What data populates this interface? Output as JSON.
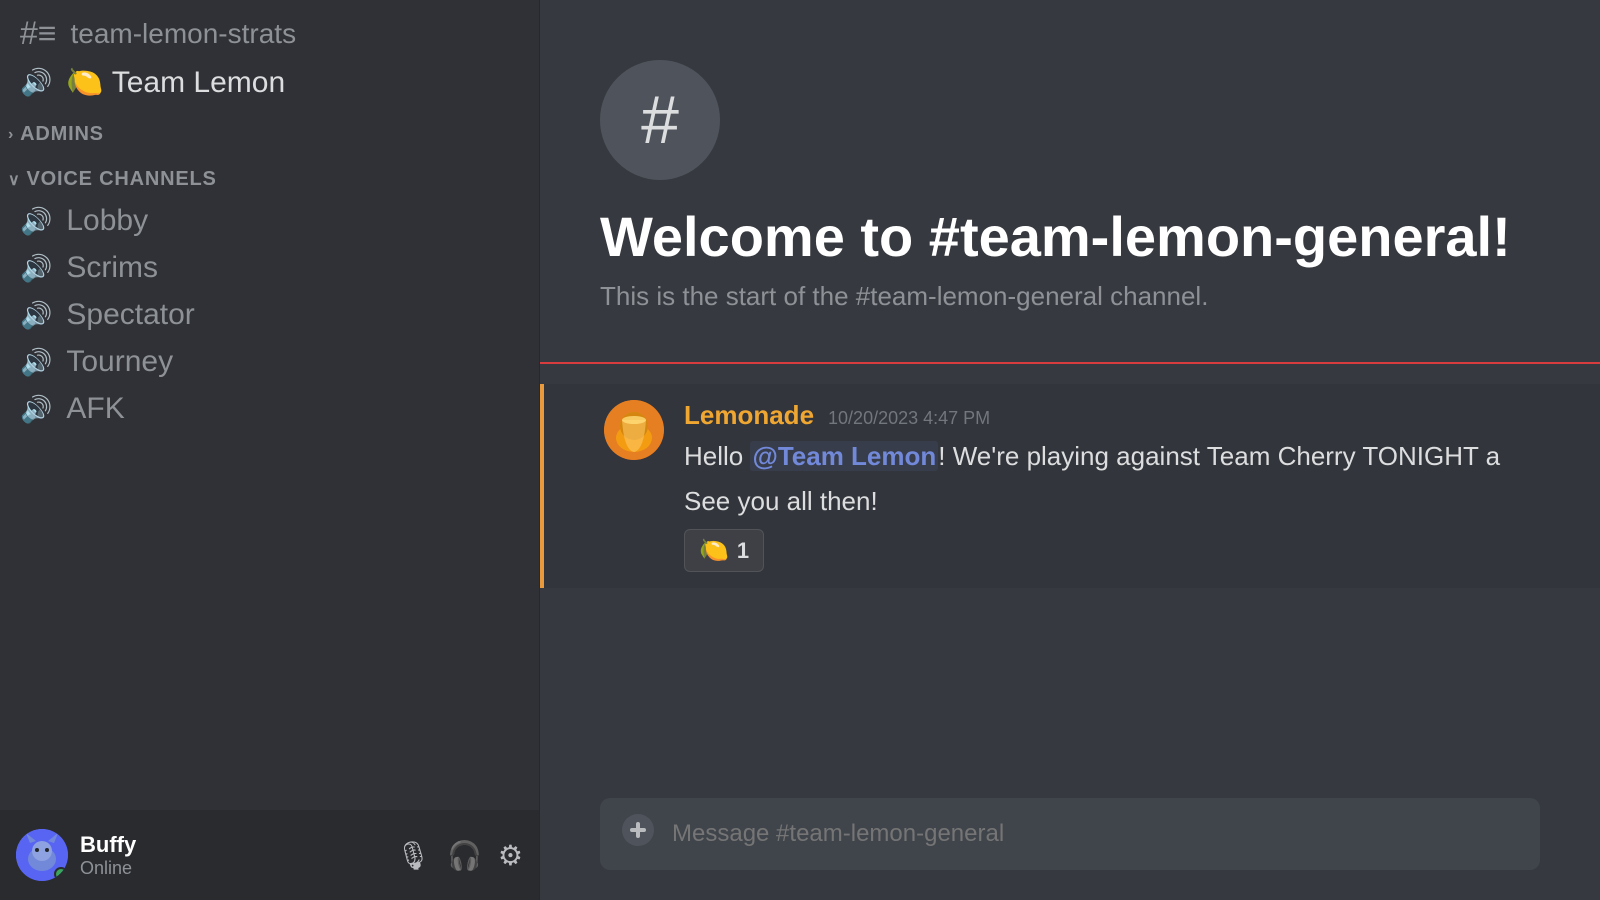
{
  "sidebar": {
    "channels": [
      {
        "id": "team-lemon-strats",
        "type": "text",
        "name": "team-lemon-strats"
      }
    ],
    "voiceChannelItem": {
      "icon": "🔊",
      "emoji": "🍋",
      "name": "Team Lemon"
    },
    "sections": [
      {
        "id": "admins",
        "label": "ADMINS",
        "collapsed": true,
        "caret": "›"
      },
      {
        "id": "voice-channels",
        "label": "VOICE CHANNELS",
        "collapsed": false,
        "caret": "∨",
        "channels": [
          {
            "id": "lobby",
            "name": "Lobby"
          },
          {
            "id": "scrims",
            "name": "Scrims"
          },
          {
            "id": "spectator",
            "name": "Spectator"
          },
          {
            "id": "tourney",
            "name": "Tourney"
          },
          {
            "id": "afk",
            "name": "AFK"
          }
        ]
      }
    ]
  },
  "user": {
    "name": "Buffy",
    "status": "Online",
    "avatar_emoji": "🐱"
  },
  "controls": {
    "mic_icon": "🎙",
    "headset_icon": "🎧",
    "settings_icon": "⚙"
  },
  "main": {
    "channel_name": "#team-lemon-general",
    "welcome_title": "Welcome to #team-lemon-general!",
    "welcome_subtitle": "This is the start of the #team-lemon-general channel.",
    "hash_icon": "#",
    "divider_color": "#d83c3e"
  },
  "messages": [
    {
      "id": "msg1",
      "author": "Lemonade",
      "author_color": "#f0a732",
      "timestamp": "10/20/2023 4:47 PM",
      "avatar_emoji": "🍊",
      "line1_prefix": "Hello ",
      "mention": "@Team Lemon",
      "line1_suffix": "! We're playing against Team Cherry TONIGHT a",
      "line2": "See you all then!",
      "reaction_emoji": "🍋",
      "reaction_count": "1"
    }
  ],
  "input": {
    "placeholder": "Message #team-lemon-general",
    "add_icon": "➕"
  }
}
